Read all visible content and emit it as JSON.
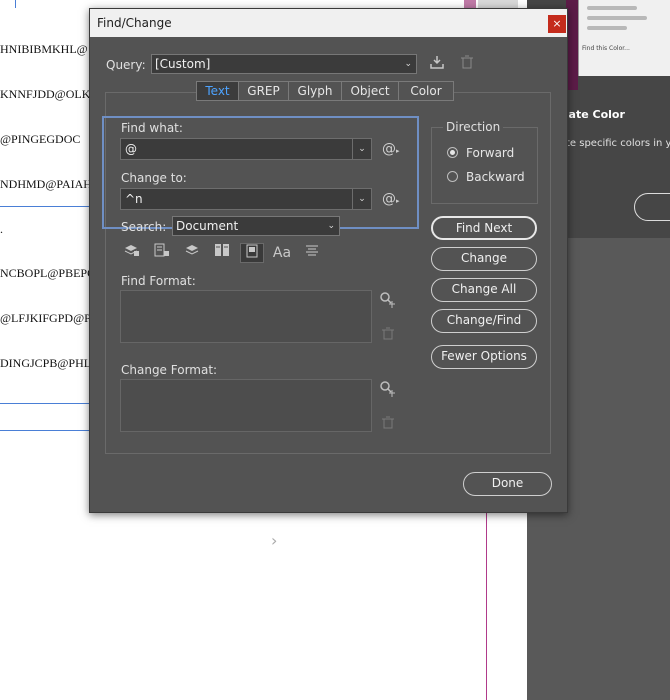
{
  "background": {
    "doc_lines_top": [
      "HNIBIBMKHL@",
      "KNNFJDD@OLK",
      "@PINGEGDOC",
      "NDHMD@PAIAH",
      "."
    ],
    "doc_lines_mid": [
      "NCBOPL@PBEPQ",
      "@LFJKIFGPD@PL",
      "DINGJCPB@PHL"
    ],
    "right_heading": "cate Color",
    "right_sub": "te specific colors in yo",
    "preview_small": "Find this Color..."
  },
  "dialog": {
    "title": "Find/Change",
    "close_glyph": "×",
    "query_label": "Query:",
    "query_value": "[Custom]",
    "tabs": [
      {
        "label": "Text",
        "active": true
      },
      {
        "label": "GREP",
        "active": false
      },
      {
        "label": "Glyph",
        "active": false
      },
      {
        "label": "Object",
        "active": false
      },
      {
        "label": "Color",
        "active": false
      }
    ],
    "find_what_label": "Find what:",
    "find_what_value": "@",
    "change_to_label": "Change to:",
    "change_to_value": "^n",
    "search_label": "Search:",
    "search_value": "Document",
    "find_format_label": "Find Format:",
    "change_format_label": "Change Format:",
    "direction": {
      "label": "Direction",
      "options": [
        "Forward",
        "Backward"
      ],
      "selected": "Forward"
    },
    "buttons": {
      "find_next": "Find Next",
      "change": "Change",
      "change_all": "Change All",
      "change_find": "Change/Find",
      "fewer_options": "Fewer Options",
      "done": "Done"
    },
    "icons": {
      "save_query": "download-icon",
      "delete_query": "trash-icon",
      "special_chars": "at-sign-icon",
      "option_icons": [
        "locked-layers-icon",
        "locked-stories-icon",
        "hidden-layers-icon",
        "master-pages-icon",
        "footnotes-icon",
        "case-sensitive-icon",
        "whole-word-icon"
      ],
      "specify_format": "format-search-icon",
      "clear_format": "trash-icon"
    }
  }
}
